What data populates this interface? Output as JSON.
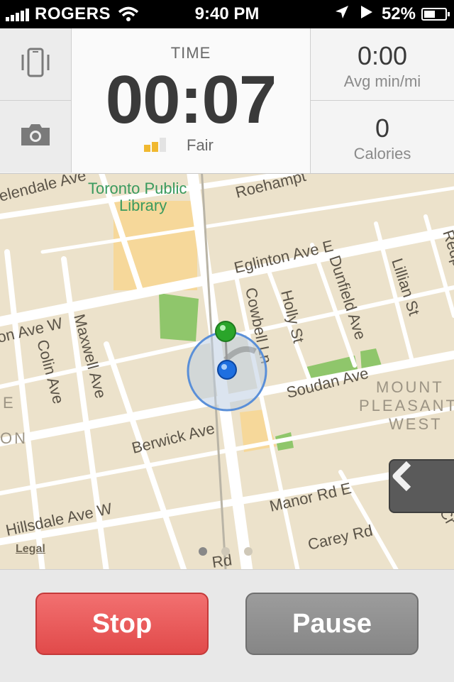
{
  "status_bar": {
    "carrier": "ROGERS",
    "time": "9:40 PM",
    "battery": "52%",
    "battery_level": 0.52,
    "icons": [
      "signal-icon",
      "wifi-icon",
      "location-arrow-icon",
      "play-icon",
      "battery-icon"
    ]
  },
  "header": {
    "time_label": "TIME",
    "time_value": "00:07",
    "gps_signal_label": "Fair",
    "gps_signal_bars": 2,
    "gps_signal_max": 3,
    "pace_value": "0:00",
    "pace_label": "Avg min/mi",
    "calories_value": "0",
    "calories_label": "Calories",
    "left_buttons": [
      "phone-vibrate-icon",
      "camera-icon"
    ]
  },
  "map": {
    "labels": {
      "library_line1": "Toronto Public",
      "library_line2": "Library",
      "glenendale": "ielendale Ave",
      "roehampton": "Roehampt",
      "eglinton": "Eglinton Ave E",
      "eglinton_w": "on Ave W",
      "colin": "Colin Ave",
      "maxwell": "Maxwell Ave",
      "cowbell": "Cowbell Ln",
      "holly": "Holly St",
      "dunfield": "Dunfield Ave",
      "lillian": "Lillian St",
      "redpath": "Redpath",
      "soudan": "Soudan Ave",
      "berwick": "Berwick Ave",
      "mount1": "MOUNT",
      "mount2": "PLEASANT",
      "mount3": "WEST",
      "e_edge": "E",
      "on_edge": "ON",
      "manor": "Manor Rd E",
      "hillsdale": "Hillsdale Ave W",
      "carey": "Carey Rd",
      "bottom_rd": "Rd",
      "cr_edge": "d Cr"
    },
    "legal": "Legal",
    "page_dots": 3,
    "active_dot": 0
  },
  "controls": {
    "stop_label": "Stop",
    "pause_label": "Pause"
  },
  "colors": {
    "stop": "#e8595a",
    "pause": "#8e8e8e",
    "map_land": "#ece2cb",
    "park": "#8fc66b",
    "pin": "#2aa52a",
    "location": "#1e6fe0"
  }
}
